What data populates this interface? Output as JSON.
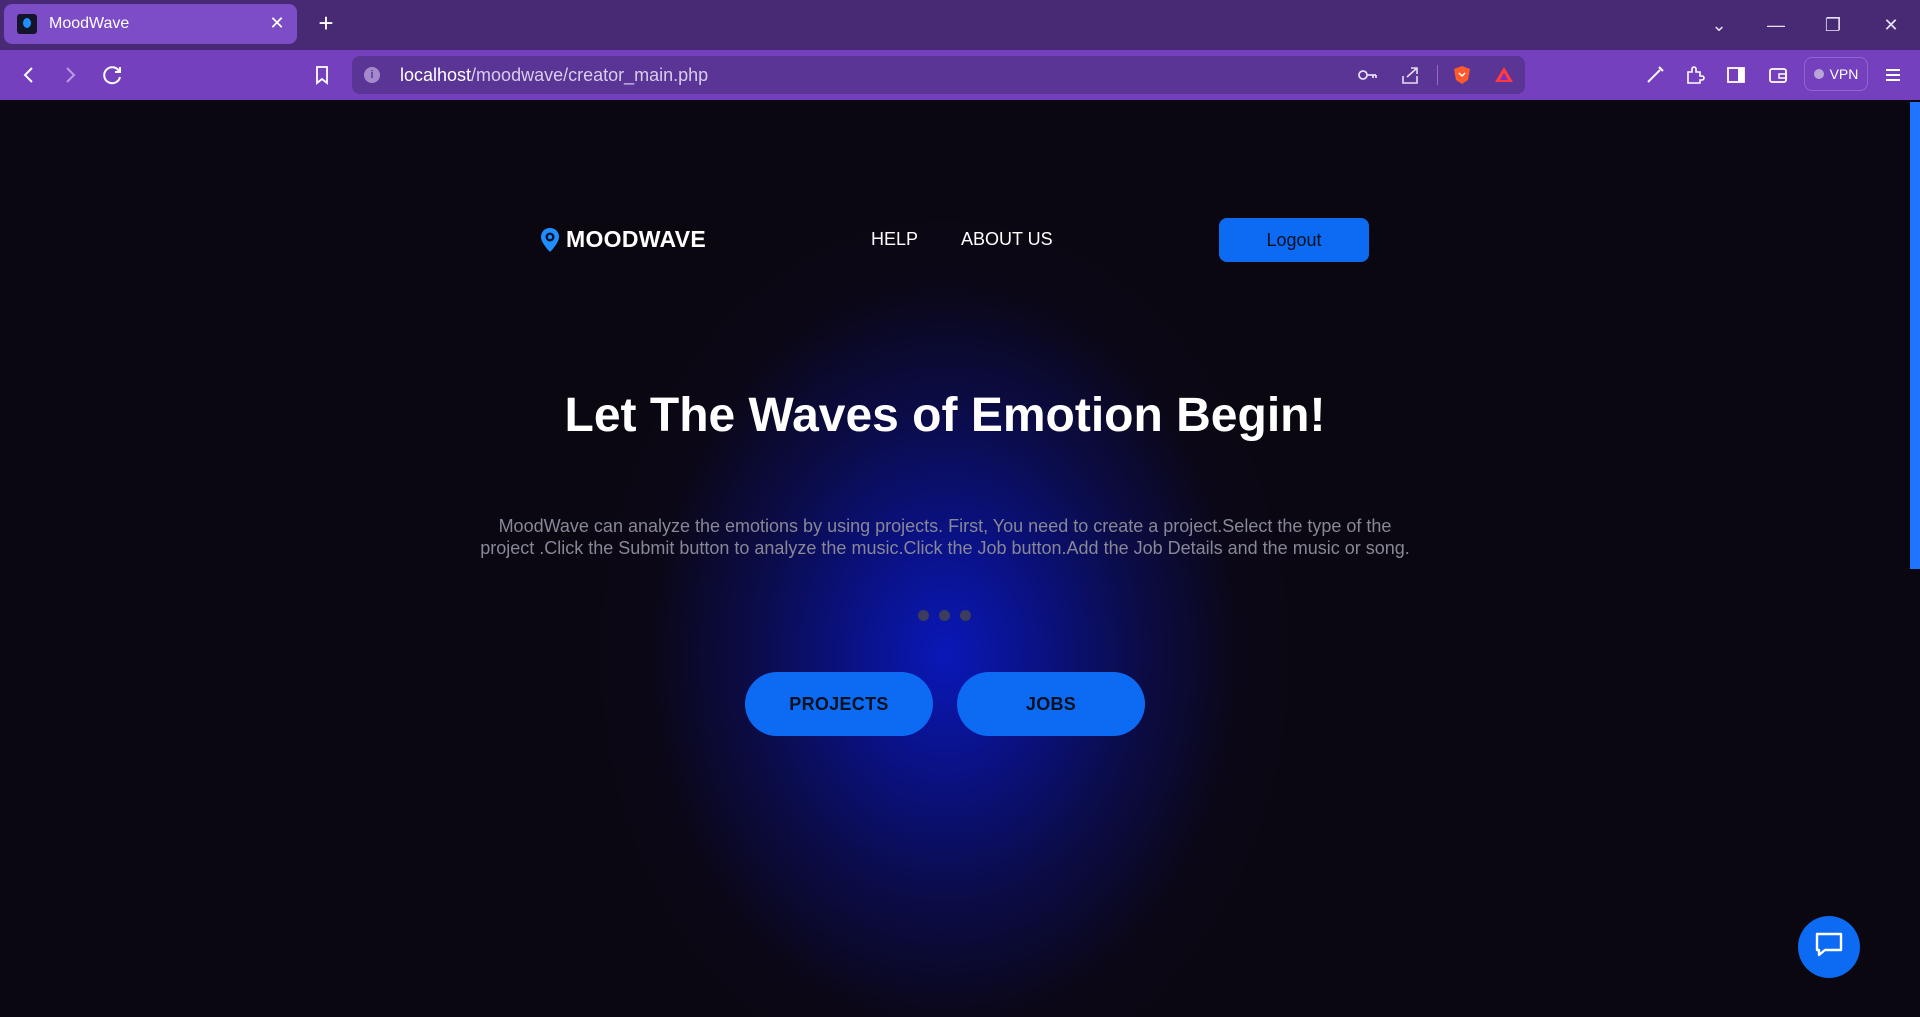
{
  "browser": {
    "tab_title": "MoodWave",
    "url_host": "localhost",
    "url_path": "/moodwave/creator_main.php",
    "vpn_label": "VPN"
  },
  "header": {
    "brand": "MOODWAVE",
    "nav": [
      "HELP",
      "ABOUT US"
    ],
    "logout_label": "Logout"
  },
  "hero": {
    "title": "Let The Waves of Emotion Begin!",
    "description": "MoodWave can analyze the emotions by using projects. First, You need to create a project.Select the type of the project .Click the Submit button to analyze the music.Click the Job button.Add the Job Details and the music or song.",
    "carousel_dots": 3
  },
  "actions": {
    "projects_label": "PROJECTS",
    "jobs_label": "JOBS"
  },
  "colors": {
    "accent": "#0c6bf2",
    "tab_bar": "#472a73",
    "toolbar": "#7540bd",
    "page_bg": "#0b0710"
  },
  "icons": [
    "back-icon",
    "forward-icon",
    "reload-icon",
    "bookmark-icon",
    "info-icon",
    "key-icon",
    "share-icon",
    "brave-shields-icon",
    "brave-rewards-icon",
    "wand-icon",
    "extensions-icon",
    "sidebar-icon",
    "wallet-icon",
    "menu-icon",
    "chat-icon"
  ]
}
